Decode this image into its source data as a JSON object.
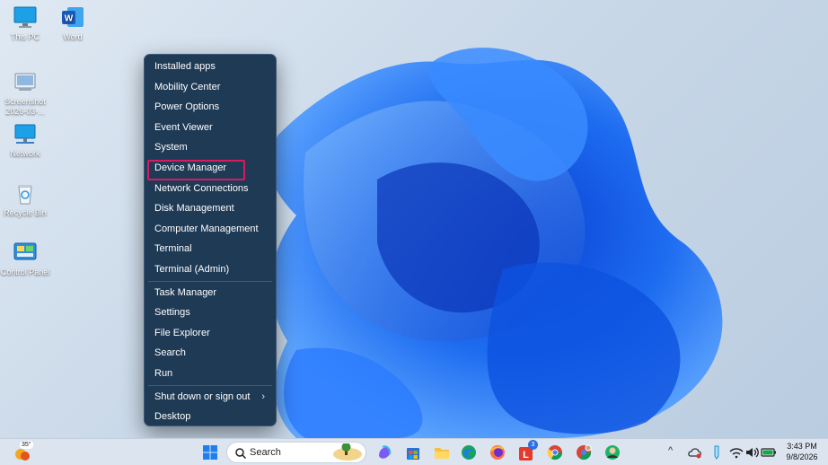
{
  "desktop_icons": [
    {
      "name": "this-pc",
      "label": "This PC"
    },
    {
      "name": "word",
      "label": "Word"
    },
    {
      "name": "screenshot",
      "label": "Screenshot 2026-03-..."
    },
    {
      "name": "network",
      "label": "Network"
    },
    {
      "name": "recycle-bin",
      "label": "Recycle Bin"
    },
    {
      "name": "control-panel",
      "label": "Control Panel"
    }
  ],
  "menu": {
    "items": [
      "Installed apps",
      "Mobility Center",
      "Power Options",
      "Event Viewer",
      "System",
      "Device Manager",
      "Network Connections",
      "Disk Management",
      "Computer Management",
      "Terminal",
      "Terminal (Admin)",
      "Task Manager",
      "Settings",
      "File Explorer",
      "Search",
      "Run",
      "Shut down or sign out",
      "Desktop"
    ],
    "highlighted": "Device Manager",
    "submenu_glyph": "›"
  },
  "taskbar": {
    "weather_temp": "35°",
    "search_placeholder": "Search",
    "badge_count": "3",
    "time": "3:43 PM",
    "date": "9/8/2026",
    "tray_chevron": "^"
  },
  "colors": {
    "menu_bg": "#1f3a55",
    "highlight_border": "#d81b60",
    "taskbar_bg": "#dce5ef"
  }
}
